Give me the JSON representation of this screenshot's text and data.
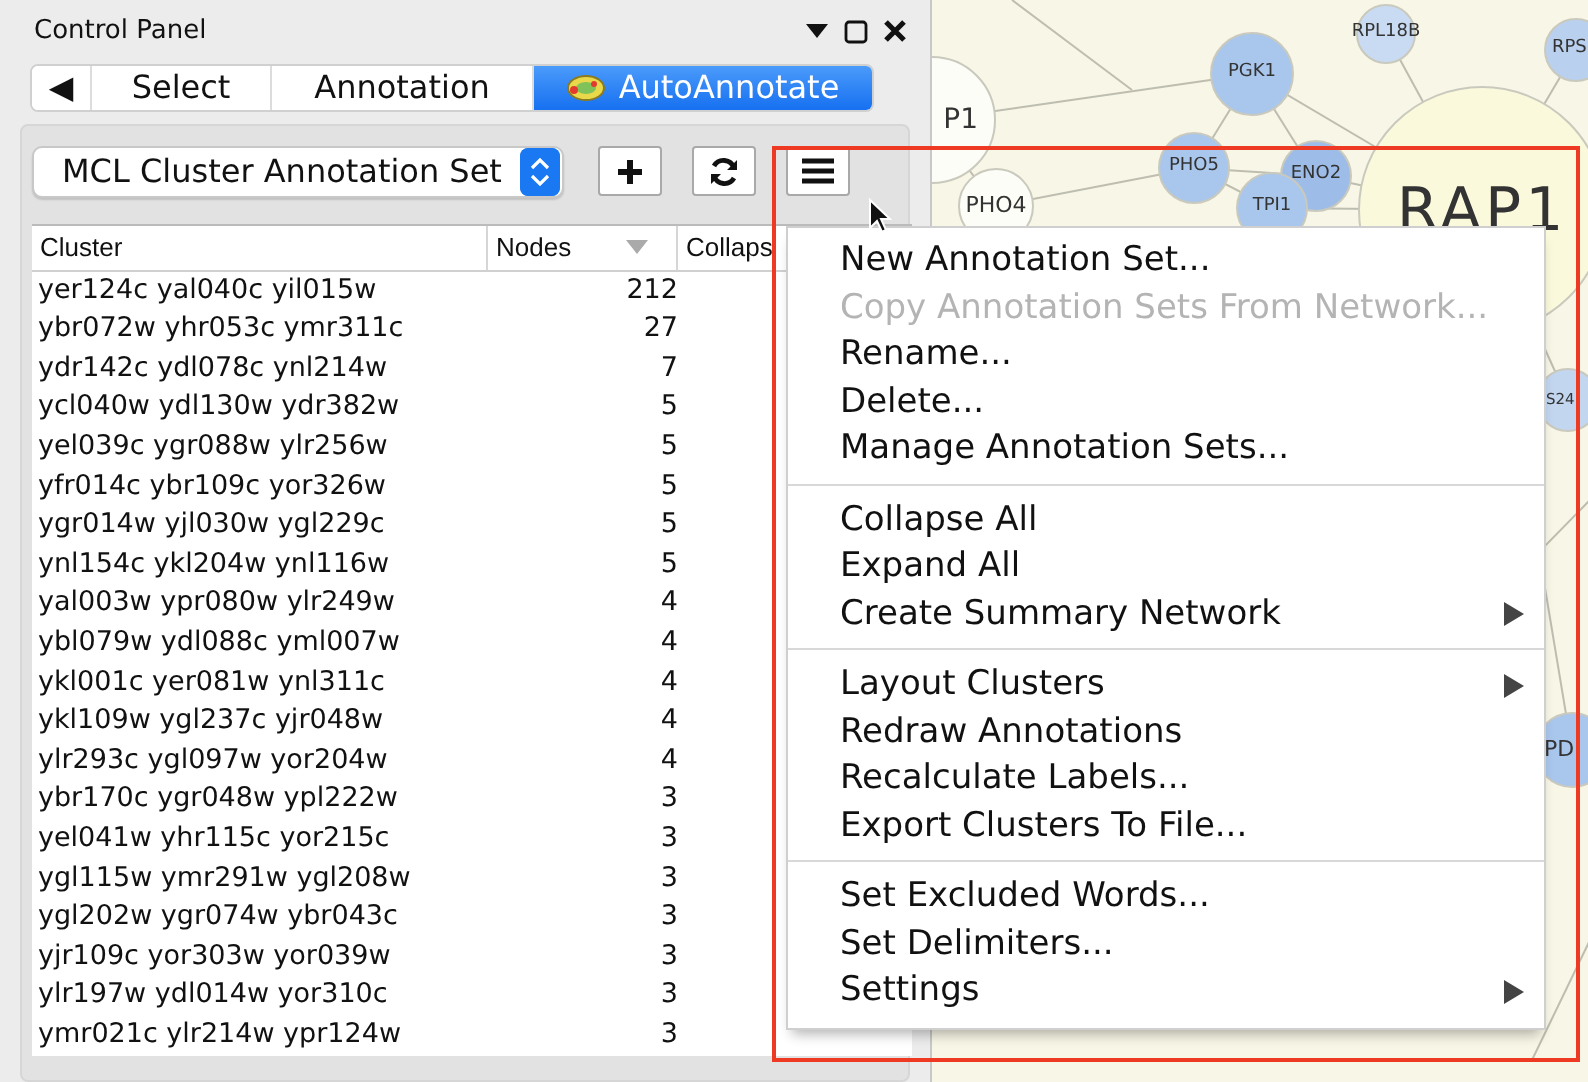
{
  "panel": {
    "title": "Control Panel"
  },
  "tabs": [
    {
      "kind": "back",
      "label": "◀",
      "selected": false
    },
    {
      "kind": "text",
      "label": "Select",
      "selected": false
    },
    {
      "kind": "text",
      "label": "Annotation",
      "selected": false
    },
    {
      "kind": "app",
      "label": "AutoAnnotate",
      "selected": true
    }
  ],
  "annotation_set": {
    "value": "MCL Cluster Annotation Set"
  },
  "table": {
    "columns": [
      {
        "label": "Cluster",
        "sorted": false
      },
      {
        "label": "Nodes",
        "sorted": true
      },
      {
        "label": "Collaps",
        "sorted": false
      }
    ],
    "rows": [
      [
        "yer124c yal040c yil015w",
        "212"
      ],
      [
        "ybr072w yhr053c ymr311c",
        "27"
      ],
      [
        "ydr142c ydl078c ynl214w",
        "7"
      ],
      [
        "ycl040w ydl130w ydr382w",
        "5"
      ],
      [
        "yel039c ygr088w ylr256w",
        "5"
      ],
      [
        "yfr014c ybr109c yor326w",
        "5"
      ],
      [
        "ygr014w yjl030w ygl229c",
        "5"
      ],
      [
        "ynl154c ykl204w ynl116w",
        "5"
      ],
      [
        "yal003w ypr080w ylr249w",
        "4"
      ],
      [
        "ybl079w ydl088c yml007w",
        "4"
      ],
      [
        "ykl001c yer081w ynl311c",
        "4"
      ],
      [
        "ykl109w ygl237c yjr048w",
        "4"
      ],
      [
        "ylr293c ygl097w yor204w",
        "4"
      ],
      [
        "ybr170c ygr048w ypl222w",
        "3"
      ],
      [
        "yel041w yhr115c yor215c",
        "3"
      ],
      [
        "ygl115w ymr291w ygl208w",
        "3"
      ],
      [
        "ygl202w ygr074w ybr043c",
        "3"
      ],
      [
        "yjr109c yor303w yor039w",
        "3"
      ],
      [
        "ylr197w ydl014w yor310c",
        "3"
      ],
      [
        "ymr021c ylr214w ypr124w",
        "3"
      ]
    ]
  },
  "network": {
    "nodes": [
      {
        "label": "PGK1",
        "color": "#a9c6ec"
      },
      {
        "label": "RPL18B",
        "color": "#c9dbf2"
      },
      {
        "label": "RPS",
        "color": "#b9d0ef"
      },
      {
        "label": "P1",
        "color": "#fdfdf8"
      },
      {
        "label": "PHO4",
        "color": "#fdfdf8"
      },
      {
        "label": "PHO5",
        "color": "#a9c6ec"
      },
      {
        "label": "ENO2",
        "color": "#9dbde8"
      },
      {
        "label": "TPI1",
        "color": "#a9c6ec"
      },
      {
        "label": "RAP1",
        "color": "#fbf9dc"
      },
      {
        "label": "S24",
        "color": "#c2d6f0"
      },
      {
        "label": "PD",
        "color": "#a9c6ec"
      }
    ]
  },
  "menu": {
    "items": [
      {
        "kind": "item",
        "label": "New Annotation Set...",
        "disabled": false,
        "submenu": false
      },
      {
        "kind": "item",
        "label": "Copy Annotation Sets From Network...",
        "disabled": true,
        "submenu": false
      },
      {
        "kind": "item",
        "label": "Rename...",
        "disabled": false,
        "submenu": false
      },
      {
        "kind": "item",
        "label": "Delete...",
        "disabled": false,
        "submenu": false
      },
      {
        "kind": "item",
        "label": "Manage Annotation Sets...",
        "disabled": false,
        "submenu": false
      },
      {
        "kind": "separator"
      },
      {
        "kind": "item",
        "label": "Collapse All",
        "disabled": false,
        "submenu": false
      },
      {
        "kind": "item",
        "label": "Expand All",
        "disabled": false,
        "submenu": false
      },
      {
        "kind": "item",
        "label": "Create Summary Network",
        "disabled": false,
        "submenu": true
      },
      {
        "kind": "separator"
      },
      {
        "kind": "item",
        "label": "Layout Clusters",
        "disabled": false,
        "submenu": true
      },
      {
        "kind": "item",
        "label": "Redraw Annotations",
        "disabled": false,
        "submenu": false
      },
      {
        "kind": "item",
        "label": "Recalculate Labels...",
        "disabled": false,
        "submenu": false
      },
      {
        "kind": "item",
        "label": "Export Clusters To File...",
        "disabled": false,
        "submenu": false
      },
      {
        "kind": "separator"
      },
      {
        "kind": "item",
        "label": "Set Excluded Words...",
        "disabled": false,
        "submenu": false
      },
      {
        "kind": "item",
        "label": "Set Delimiters...",
        "disabled": false,
        "submenu": false
      },
      {
        "kind": "item",
        "label": "Settings",
        "disabled": false,
        "submenu": true
      }
    ]
  }
}
